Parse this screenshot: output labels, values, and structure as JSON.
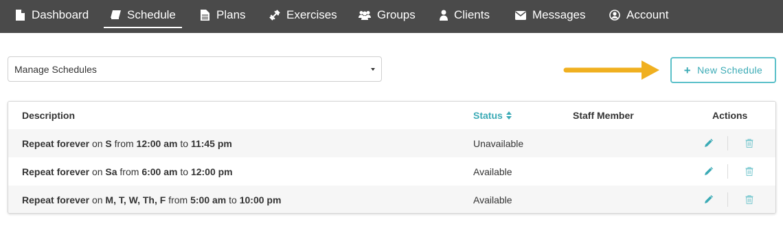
{
  "nav": {
    "items": [
      {
        "label": "Dashboard",
        "icon": "file-icon"
      },
      {
        "label": "Schedule",
        "icon": "book-icon",
        "active": true
      },
      {
        "label": "Plans",
        "icon": "document-icon"
      },
      {
        "label": "Exercises",
        "icon": "dumbbell-icon"
      },
      {
        "label": "Groups",
        "icon": "users-icon"
      },
      {
        "label": "Clients",
        "icon": "user-icon"
      },
      {
        "label": "Messages",
        "icon": "envelope-icon"
      },
      {
        "label": "Account",
        "icon": "user-circle-icon"
      }
    ]
  },
  "manage": {
    "value": "Manage Schedules"
  },
  "toolbar": {
    "new_schedule_label": "New Schedule"
  },
  "table": {
    "headers": {
      "description": "Description",
      "status": "Status",
      "staff": "Staff Member",
      "actions": "Actions"
    },
    "rows": [
      {
        "repeat": "Repeat forever",
        "on": "on",
        "days": "S",
        "from": "from",
        "start": "12:00 am",
        "to": "to",
        "end": "11:45 pm",
        "status": "Unavailable",
        "staff": ""
      },
      {
        "repeat": "Repeat forever",
        "on": "on",
        "days": "Sa",
        "from": "from",
        "start": "6:00 am",
        "to": "to",
        "end": "12:00 pm",
        "status": "Available",
        "staff": ""
      },
      {
        "repeat": "Repeat forever",
        "on": "on",
        "days": "M, T, W, Th, F",
        "from": "from",
        "start": "5:00 am",
        "to": "to",
        "end": "10:00 pm",
        "status": "Available",
        "staff": ""
      }
    ]
  },
  "colors": {
    "nav_bg": "#4a4a4a",
    "accent": "#3aaab5",
    "arrow": "#f0b020",
    "row_alt": "#f6f6f6"
  }
}
